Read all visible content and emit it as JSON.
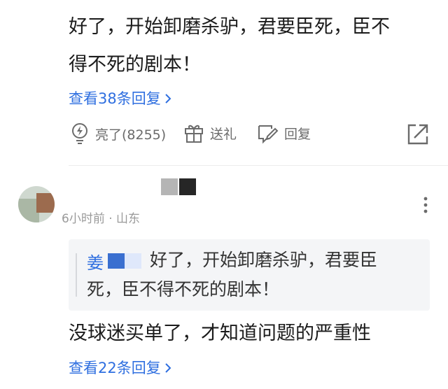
{
  "comment1": {
    "text_line1": "好了，开始卸磨杀驴，君要臣死，臣不",
    "text_line2": "得不死的剧本！",
    "view_replies": "查看38条回复",
    "actions": {
      "like_label": "亮了(8255)",
      "gift_label": "送礼",
      "reply_label": "回复"
    }
  },
  "comment2": {
    "meta": "6小时前 · 山东",
    "quote": {
      "author": "姜",
      "text_line1": "好了，开始卸磨杀驴，君要臣",
      "text_line2": "死，臣不得不死的剧本！"
    },
    "text": "没球迷买单了，才知道问题的严重性",
    "view_replies": "查看22条回复"
  },
  "colors": {
    "link": "#2f6fe0",
    "action_gray": "#6b6b6b",
    "quote_bg": "#f4f5f7"
  },
  "icons": [
    "lightbulb-icon",
    "gift-icon",
    "reply-edit-icon",
    "share-icon",
    "chevron-right-icon",
    "more-vertical-icon"
  ]
}
